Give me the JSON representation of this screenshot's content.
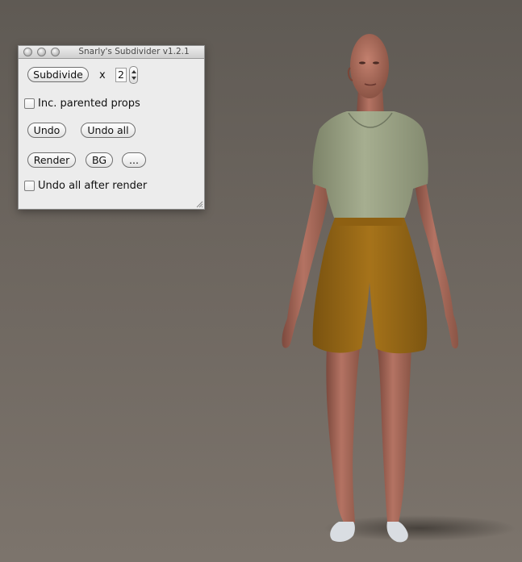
{
  "window": {
    "title": "Snarly's Subdivider v1.2.1"
  },
  "controls": {
    "subdivide_label": "Subdivide",
    "multiplier_symbol": "x",
    "subdivision_level": "2",
    "inc_parented_props_label": "Inc. parented props",
    "inc_parented_props_checked": false,
    "undo_label": "Undo",
    "undo_all_label": "Undo all",
    "render_label": "Render",
    "bg_label": "BG",
    "more_label": "...",
    "undo_all_after_render_label": "Undo all after render",
    "undo_all_after_render_checked": false
  },
  "icons": {
    "close": "close-icon",
    "minimize": "minimize-icon",
    "zoom": "zoom-icon",
    "stepper_up": "chevron-up-icon",
    "stepper_down": "chevron-down-icon",
    "resize": "resize-grip-icon"
  },
  "colors": {
    "background": "#6b645d",
    "palette": "#ececec",
    "shirt": "#9fa88a",
    "shorts": "#9b6b16",
    "skin": "#a96a58"
  }
}
